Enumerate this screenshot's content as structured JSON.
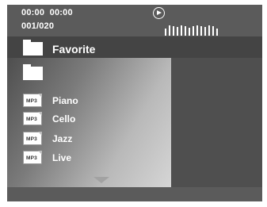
{
  "status": {
    "time_text": "00:00  00:00",
    "track_text": "001/020",
    "play_icon": "play-circle-icon",
    "level_bar_heights": [
      9,
      13,
      12,
      11,
      13,
      12,
      10,
      12,
      13,
      12,
      11,
      13,
      12,
      9
    ]
  },
  "folder": {
    "name": "Favorite",
    "icon": "folder-icon"
  },
  "subfolder": {
    "icon": "folder-icon"
  },
  "files": [
    {
      "icon_label": "MP3",
      "name": "Piano"
    },
    {
      "icon_label": "MP3",
      "name": "Cello"
    },
    {
      "icon_label": "MP3",
      "name": "Jazz"
    },
    {
      "icon_label": "MP3",
      "name": "Live"
    }
  ],
  "scroll": {
    "down_icon": "arrow-down-icon"
  }
}
